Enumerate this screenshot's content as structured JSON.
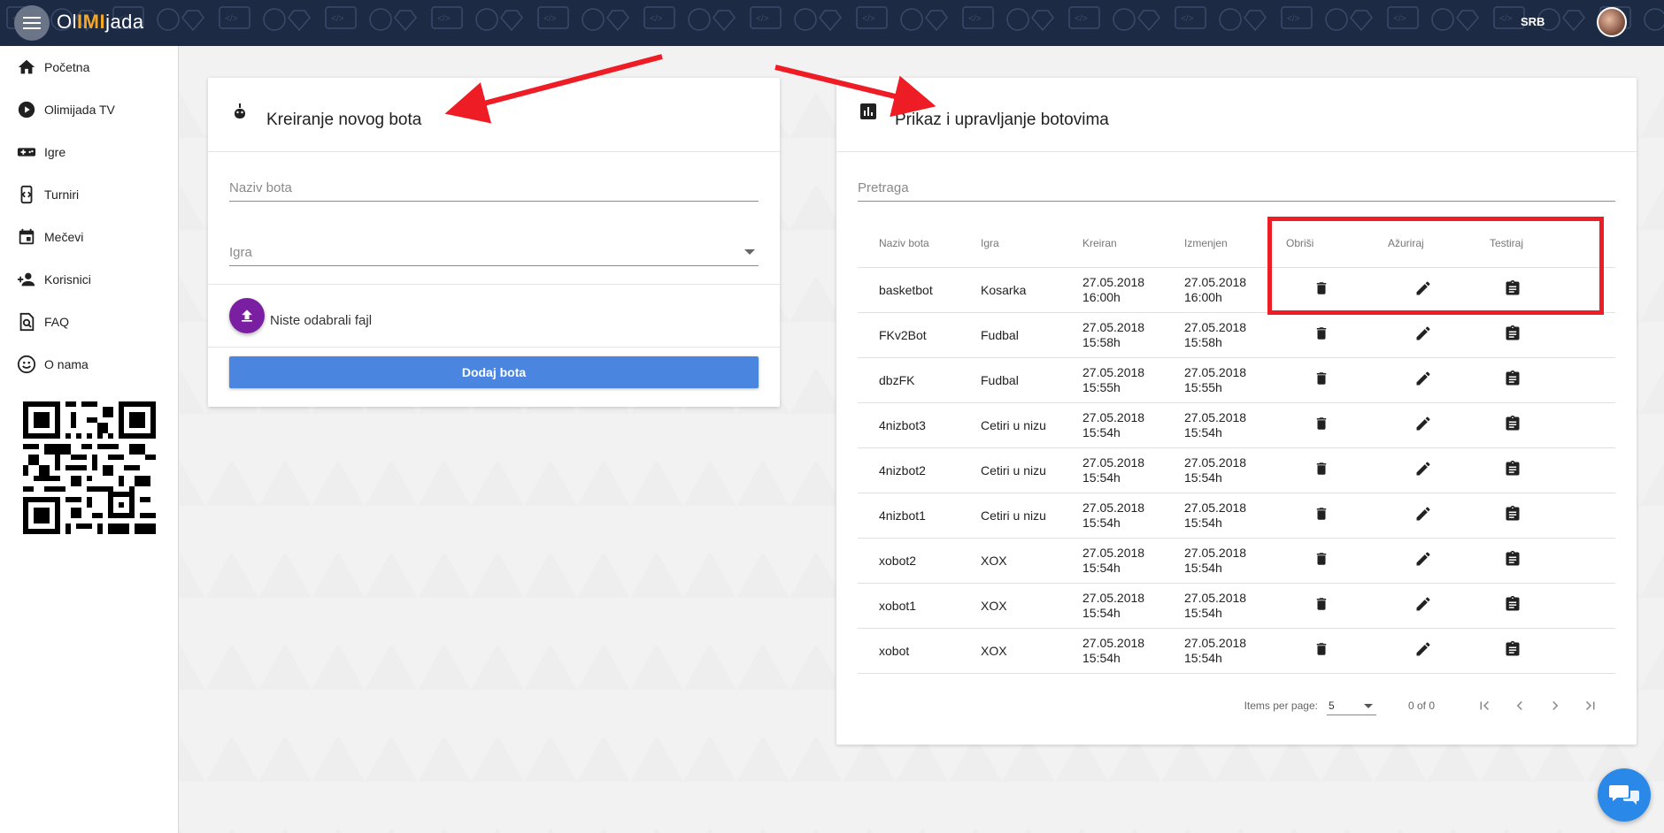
{
  "app": {
    "logo_prefix": "Ol",
    "logo_accent": "IMI",
    "logo_suffix": "jada",
    "language": "SRB"
  },
  "sidebar": {
    "items": [
      {
        "label": "Početna",
        "icon": "home-icon"
      },
      {
        "label": "Olimijada TV",
        "icon": "play-icon"
      },
      {
        "label": "Igre",
        "icon": "gamepad-icon"
      },
      {
        "label": "Turniri",
        "icon": "tournament-icon"
      },
      {
        "label": "Mečevi",
        "icon": "calendar-icon"
      },
      {
        "label": "Korisnici",
        "icon": "users-icon"
      },
      {
        "label": "FAQ",
        "icon": "faq-icon"
      },
      {
        "label": "O nama",
        "icon": "smiley-icon"
      }
    ]
  },
  "create_card": {
    "title": "Kreiranje novog bota",
    "name_placeholder": "Naziv bota",
    "game_placeholder": "Igra",
    "file_status": "Niste odabrali fajl",
    "submit_label": "Dodaj bota"
  },
  "manage_card": {
    "title": "Prikaz i upravljanje botovima",
    "search_placeholder": "Pretraga",
    "columns": [
      "Naziv bota",
      "Igra",
      "Kreiran",
      "Izmenjen",
      "Obriši",
      "Ažuriraj",
      "Testiraj"
    ],
    "rows": [
      {
        "name": "basketbot",
        "game": "Kosarka",
        "created_date": "27.05.2018",
        "created_time": "16:00h",
        "modified_date": "27.05.2018",
        "modified_time": "16:00h"
      },
      {
        "name": "FKv2Bot",
        "game": "Fudbal",
        "created_date": "27.05.2018",
        "created_time": "15:58h",
        "modified_date": "27.05.2018",
        "modified_time": "15:58h"
      },
      {
        "name": "dbzFK",
        "game": "Fudbal",
        "created_date": "27.05.2018",
        "created_time": "15:55h",
        "modified_date": "27.05.2018",
        "modified_time": "15:55h"
      },
      {
        "name": "4nizbot3",
        "game": "Cetiri u nizu",
        "created_date": "27.05.2018",
        "created_time": "15:54h",
        "modified_date": "27.05.2018",
        "modified_time": "15:54h"
      },
      {
        "name": "4nizbot2",
        "game": "Cetiri u nizu",
        "created_date": "27.05.2018",
        "created_time": "15:54h",
        "modified_date": "27.05.2018",
        "modified_time": "15:54h"
      },
      {
        "name": "4nizbot1",
        "game": "Cetiri u nizu",
        "created_date": "27.05.2018",
        "created_time": "15:54h",
        "modified_date": "27.05.2018",
        "modified_time": "15:54h"
      },
      {
        "name": "xobot2",
        "game": "XOX",
        "created_date": "27.05.2018",
        "created_time": "15:54h",
        "modified_date": "27.05.2018",
        "modified_time": "15:54h"
      },
      {
        "name": "xobot1",
        "game": "XOX",
        "created_date": "27.05.2018",
        "created_time": "15:54h",
        "modified_date": "27.05.2018",
        "modified_time": "15:54h"
      },
      {
        "name": "xobot",
        "game": "XOX",
        "created_date": "27.05.2018",
        "created_time": "15:54h",
        "modified_date": "27.05.2018",
        "modified_time": "15:54h"
      }
    ],
    "paginator": {
      "items_per_page_label": "Items per page:",
      "items_per_page_value": "5",
      "range_label": "0 of 0"
    }
  },
  "colors": {
    "topbar": "#1c2a44",
    "accent": "#f5a623",
    "primary_button": "#4a86e0",
    "upload_button": "#7b1fa2",
    "annotation": "#ee1c24",
    "chat_fab": "#2a88e8"
  }
}
